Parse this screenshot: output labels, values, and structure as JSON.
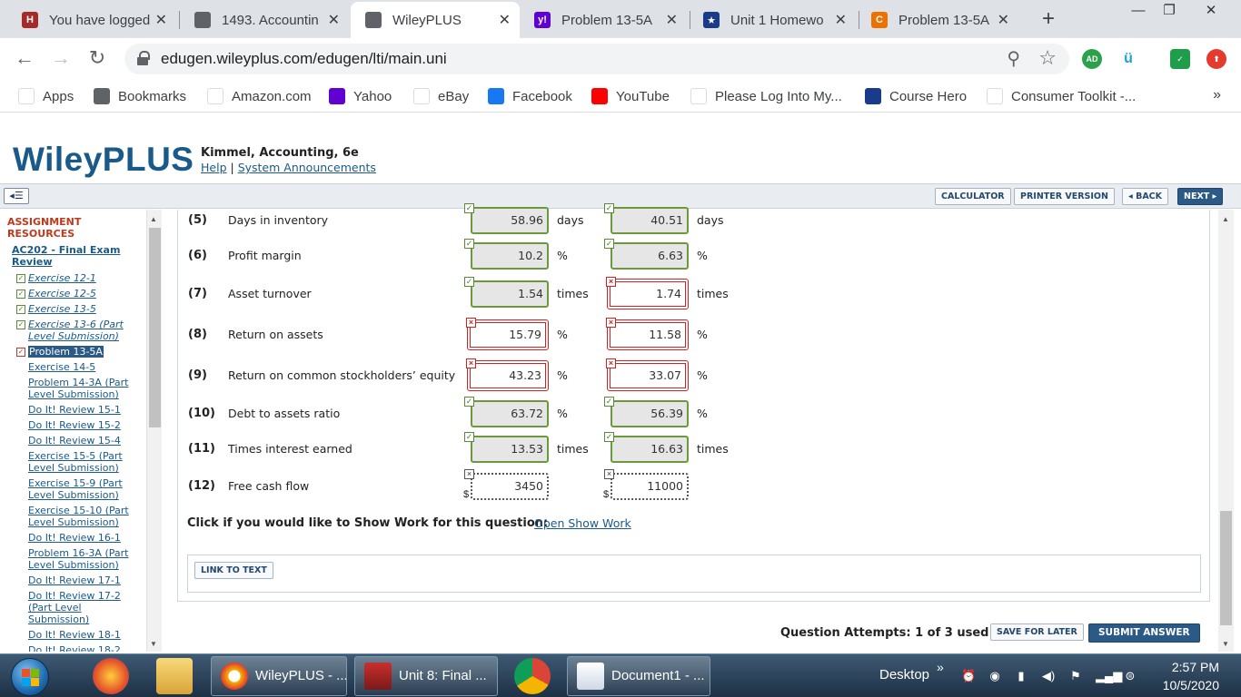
{
  "browser": {
    "tabs": [
      {
        "title": "You have logged",
        "icon": "university-favicon",
        "color": "#a52a2a",
        "glyph": "H"
      },
      {
        "title": "1493. Accountin",
        "icon": "globe-favicon",
        "color": "#5f6368",
        "glyph": ""
      },
      {
        "title": "WileyPLUS",
        "icon": "globe-favicon",
        "color": "#5f6368",
        "glyph": "",
        "active": true
      },
      {
        "title": "Problem 13-5A",
        "icon": "yahoo-favicon",
        "color": "#6001d2",
        "glyph": "y!"
      },
      {
        "title": "Unit 1 Homewo",
        "icon": "star-favicon",
        "color": "#1a3a8a",
        "glyph": "★"
      },
      {
        "title": "Problem 13-5A",
        "icon": "chegg-favicon",
        "color": "#eb7100",
        "glyph": "C"
      }
    ],
    "url": "edugen.wileyplus.com/edugen/lti/main.uni",
    "extensions": [
      "AD",
      "ü"
    ],
    "bookmarks": [
      {
        "label": "Apps",
        "icon": "apps-grid-icon",
        "color": "#ffffff"
      },
      {
        "label": "Bookmarks",
        "icon": "globe-icon",
        "color": "#5f6368"
      },
      {
        "label": "Amazon.com",
        "icon": "amazon-icon",
        "color": "#ffffff"
      },
      {
        "label": "Yahoo",
        "icon": "yahoo-icon",
        "color": "#6001d2"
      },
      {
        "label": "eBay",
        "icon": "ebay-icon",
        "color": "#ffffff"
      },
      {
        "label": "Facebook",
        "icon": "facebook-icon",
        "color": "#1877f2"
      },
      {
        "label": "YouTube",
        "icon": "youtube-icon",
        "color": "#ff0000"
      },
      {
        "label": "Please Log Into My...",
        "icon": "microsoft-icon",
        "color": "#ffffff"
      },
      {
        "label": "Course Hero",
        "icon": "star-icon",
        "color": "#1a3a8a"
      },
      {
        "label": "Consumer Toolkit -...",
        "icon": "toolkit-icon",
        "color": "#ffffff"
      }
    ],
    "more": "»"
  },
  "header": {
    "logo": "WileyPLUS",
    "course": "Kimmel, Accounting, 6e",
    "help": "Help",
    "separator": "|",
    "announcements": "System Announcements"
  },
  "toolbar": {
    "calculator": "CALCULATOR",
    "printer": "PRINTER VERSION",
    "back": "◂ BACK",
    "next": "NEXT ▸"
  },
  "sidebar": {
    "heading": "ASSIGNMENT RESOURCES",
    "assignment": "AC202 - Final Exam Review",
    "items": [
      {
        "label": "Exercise 12-1",
        "status": "done"
      },
      {
        "label": "Exercise 12-5",
        "status": "done"
      },
      {
        "label": "Exercise 13-5",
        "status": "done"
      },
      {
        "label": "Exercise 13-6 (Part Level Submission)",
        "status": "done"
      },
      {
        "label": "Problem 13-5A",
        "status": "current"
      },
      {
        "label": "Exercise 14-5",
        "status": "none"
      },
      {
        "label": "Problem 14-3A (Part Level Submission)",
        "status": "none"
      },
      {
        "label": "Do It! Review 15-1",
        "status": "none"
      },
      {
        "label": "Do It! Review 15-2",
        "status": "none"
      },
      {
        "label": "Do It! Review 15-4",
        "status": "none"
      },
      {
        "label": "Exercise 15-5 (Part Level Submission)",
        "status": "none"
      },
      {
        "label": "Exercise 15-9 (Part Level Submission)",
        "status": "none"
      },
      {
        "label": "Exercise 15-10 (Part Level Submission)",
        "status": "none"
      },
      {
        "label": "Do It! Review 16-1",
        "status": "none"
      },
      {
        "label": "Problem 16-3A (Part Level Submission)",
        "status": "none"
      },
      {
        "label": "Do It! Review 17-1",
        "status": "none"
      },
      {
        "label": "Do It! Review 17-2 (Part Level Submission)",
        "status": "none"
      },
      {
        "label": "Do It! Review 18-1",
        "status": "none"
      },
      {
        "label": "Do It! Review 18-2",
        "status": "none"
      }
    ]
  },
  "question": {
    "rows": [
      {
        "num": "(5)",
        "label": "Days in inventory",
        "v1": "58.96",
        "s1": "correct",
        "v2": "40.51",
        "s2": "correct",
        "unit": "days",
        "prefix": ""
      },
      {
        "num": "(6)",
        "label": "Profit margin",
        "v1": "10.2",
        "s1": "correct",
        "v2": "6.63",
        "s2": "correct",
        "unit": "%",
        "prefix": ""
      },
      {
        "num": "(7)",
        "label": "Asset turnover",
        "v1": "1.54",
        "s1": "correct",
        "v2": "1.74",
        "s2": "wrong",
        "unit": "times",
        "prefix": ""
      },
      {
        "num": "(8)",
        "label": "Return on assets",
        "v1": "15.79",
        "s1": "wrong",
        "v2": "11.58",
        "s2": "wrong",
        "unit": "%",
        "prefix": ""
      },
      {
        "num": "(9)",
        "label": "Return on common stockholders’ equity",
        "v1": "43.23",
        "s1": "wrong",
        "v2": "33.07",
        "s2": "wrong",
        "unit": "%",
        "prefix": ""
      },
      {
        "num": "(10)",
        "label": "Debt to assets ratio",
        "v1": "63.72",
        "s1": "correct",
        "v2": "56.39",
        "s2": "correct",
        "unit": "%",
        "prefix": ""
      },
      {
        "num": "(11)",
        "label": "Times interest earned",
        "v1": "13.53",
        "s1": "correct",
        "v2": "16.63",
        "s2": "correct",
        "unit": "times",
        "prefix": ""
      },
      {
        "num": "(12)",
        "label": "Free cash flow",
        "v1": "3450",
        "s1": "blank",
        "v2": "11000",
        "s2": "blank",
        "unit": "",
        "prefix": "$"
      }
    ],
    "show_work_prompt": "Click if you would like to Show Work for this question:",
    "show_work_link": "Open Show Work",
    "link_to_text": "LINK TO TEXT",
    "attempts": "Question Attempts: 1 of 3 used",
    "save_later": "SAVE FOR LATER",
    "submit": "SUBMIT ANSWER"
  },
  "taskbar": {
    "apps": [
      {
        "label": "WileyPLUS - ...",
        "icon": "chrome-canary-icon"
      },
      {
        "label": "Unit 8: Final ...",
        "icon": "university-icon"
      },
      {
        "label": "Document1 - ...",
        "icon": "word-document-icon"
      }
    ],
    "desktop": "Desktop",
    "time": "2:57 PM",
    "date": "10/5/2020"
  }
}
